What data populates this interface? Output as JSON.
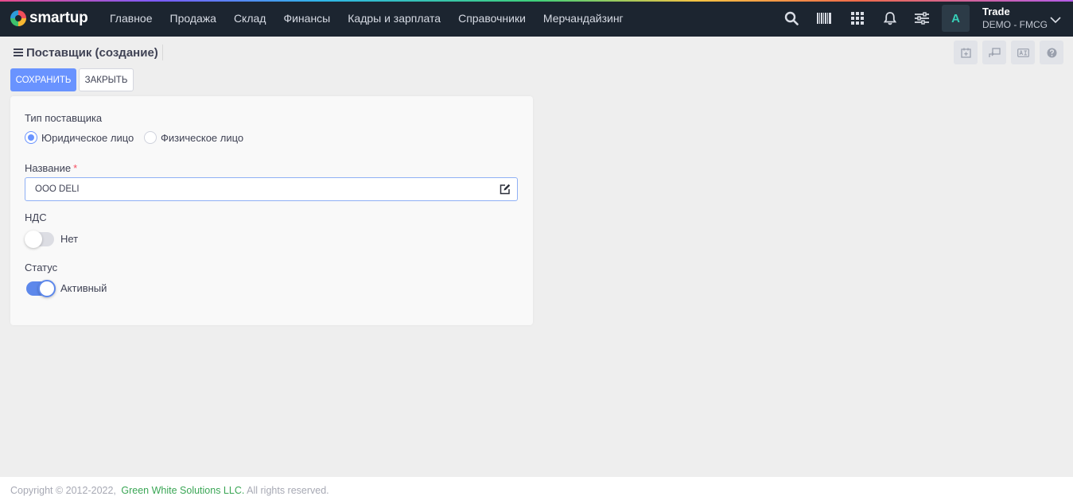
{
  "brand": {
    "name": "smartup"
  },
  "nav": {
    "menu": [
      "Главное",
      "Продажа",
      "Склад",
      "Финансы",
      "Кадры и зарплата",
      "Справочники",
      "Мерчандайзинг"
    ],
    "icons": [
      "search-icon",
      "barcode-icon",
      "apps-grid-icon",
      "bell-icon",
      "settings-sliders-icon"
    ],
    "avatar_letter": "A",
    "user": {
      "name": "Trade",
      "company": "DEMO - FMCG"
    }
  },
  "header": {
    "title": "Поставщик (создание)",
    "tools": [
      "calendar-icon",
      "transfer-icon",
      "translate-icon",
      "help-icon"
    ]
  },
  "actions": {
    "save": "СОХРАНИТЬ",
    "close": "ЗАКРЫТЬ"
  },
  "form": {
    "supplier_type": {
      "label": "Тип поставщика",
      "options": [
        "Юридическое лицо",
        "Физическое лицо"
      ],
      "selected": "Юридическое лицо"
    },
    "name": {
      "label": "Название",
      "required_mark": "*",
      "value": "OOO DELI"
    },
    "vat": {
      "label": "НДС",
      "state": "Нет",
      "on": false
    },
    "status": {
      "label": "Статус",
      "state": "Активный",
      "on": true
    }
  },
  "footer": {
    "copyright": "Copyright © 2012-2022,",
    "company": "Green White Solutions LLC.",
    "rights": "All rights reserved."
  },
  "colors": {
    "navbar": "#1c2530",
    "primary": "#6993ff",
    "footer_link": "#3aa655",
    "avatar_text": "#37d0b8"
  }
}
